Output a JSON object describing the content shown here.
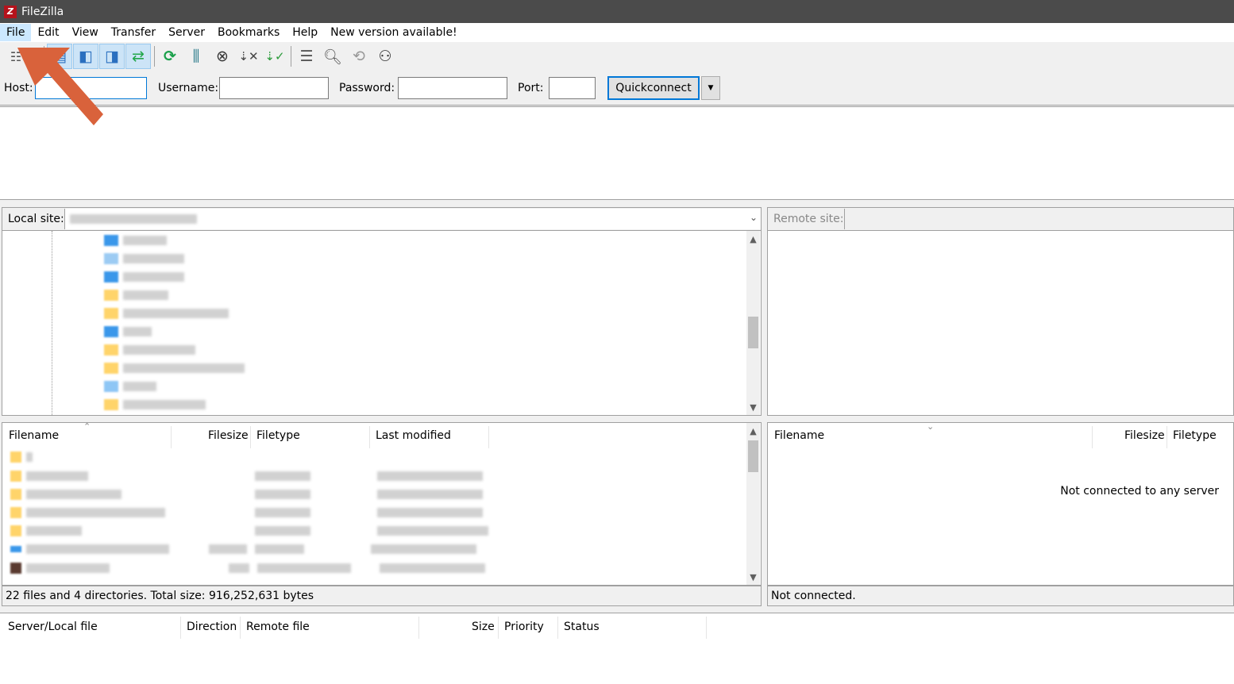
{
  "app": {
    "title": "FileZilla",
    "icon_letter": "Z"
  },
  "menu": [
    "File",
    "Edit",
    "View",
    "Transfer",
    "Server",
    "Bookmarks",
    "Help",
    "New version available!"
  ],
  "toolbar": {
    "icons": [
      "site-manager-icon",
      "dropdown-arrow-icon",
      "toggle-message-log-icon",
      "toggle-local-tree-icon",
      "toggle-remote-tree-icon",
      "toggle-transfer-queue-icon",
      "refresh-icon",
      "process-queue-icon",
      "cancel-icon",
      "disconnect-icon",
      "reconnect-icon",
      "directory-listing-filters-icon",
      "search-remote-files-icon",
      "synchronized-browsing-icon",
      "find-files-icon"
    ]
  },
  "quickconnect": {
    "host_label": "Host:",
    "username_label": "Username:",
    "password_label": "Password:",
    "port_label": "Port:",
    "button": "Quickconnect",
    "host_value": "",
    "username_value": "",
    "password_value": "",
    "port_value": ""
  },
  "local": {
    "site_label": "Local site:",
    "columns": [
      "Filename",
      "Filesize",
      "Filetype",
      "Last modified"
    ],
    "status": "22 files and 4 directories. Total size: 916,252,631 bytes"
  },
  "remote": {
    "site_label": "Remote site:",
    "columns": [
      "Filename",
      "Filesize",
      "Filetype"
    ],
    "empty_message": "Not connected to any server",
    "status": "Not connected."
  },
  "queue": {
    "columns": [
      "Server/Local file",
      "Direction",
      "Remote file",
      "Size",
      "Priority",
      "Status"
    ]
  },
  "colors": {
    "titlebar": "#4b4b4b",
    "menu_active": "#cce8ff",
    "accent": "#0078d7",
    "annotation_arrow": "#d9623b"
  }
}
